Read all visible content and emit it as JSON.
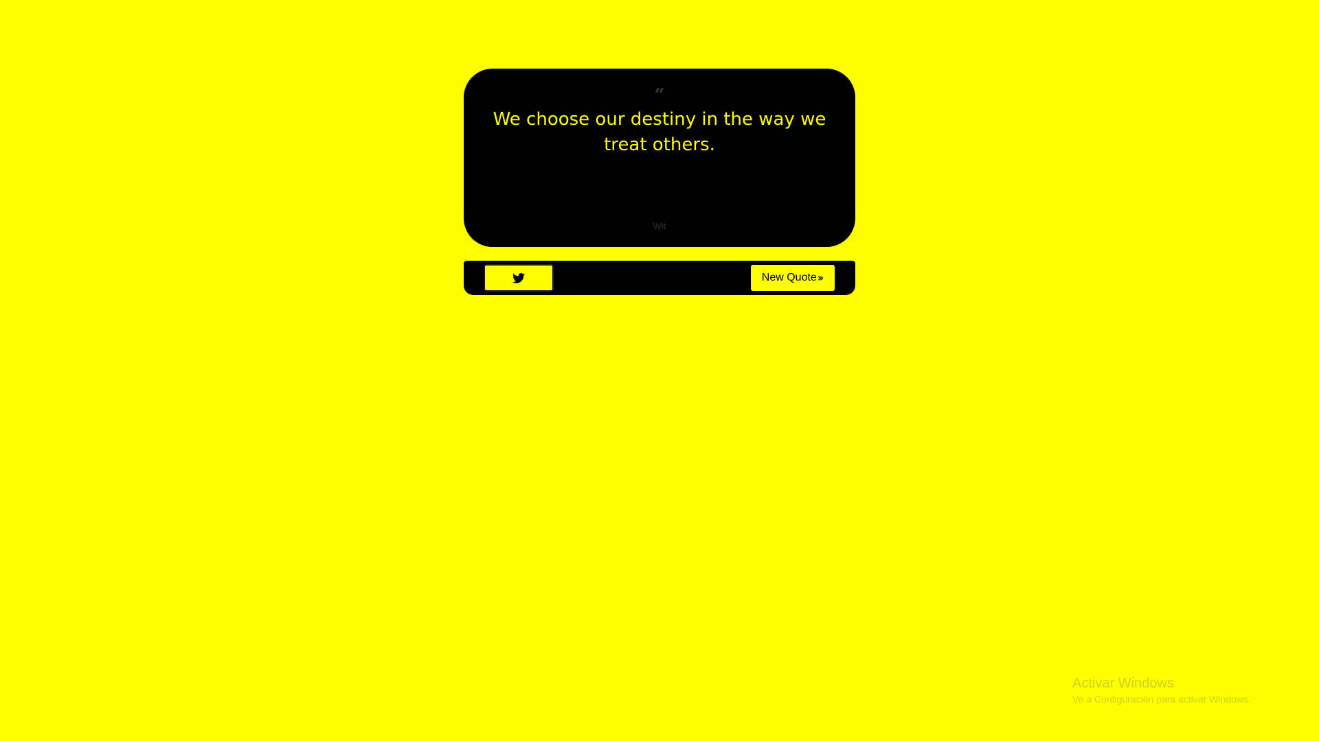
{
  "colors": {
    "background": "#ffff00",
    "card": "#000000",
    "accent_text": "#ffff00"
  },
  "quote": {
    "icon": "quote-left-icon",
    "text": "We choose our destiny in the way we treat others.",
    "author": "Wit"
  },
  "actions": {
    "tweet_icon": "twitter-icon",
    "new_quote_label": "New Quote",
    "new_quote_icon": "double-chevron-right-icon"
  },
  "watermark": {
    "title": "Activar Windows",
    "subtitle": "Ve a Configuración para activar Windows."
  }
}
